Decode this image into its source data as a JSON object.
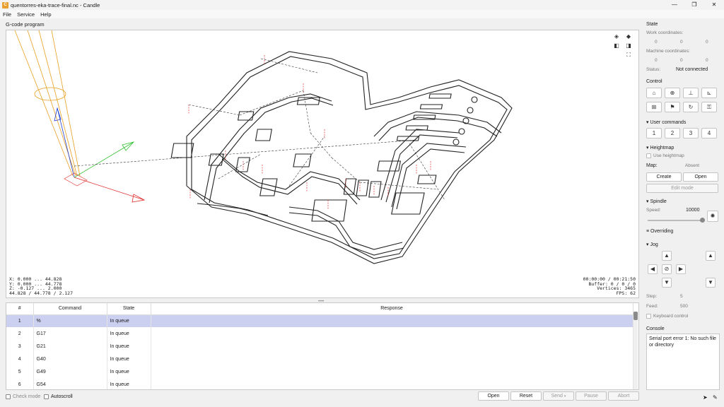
{
  "window": {
    "title": "quentorres-eka-trace-final.nc - Candle",
    "controls": [
      "—",
      "❐",
      "✕"
    ]
  },
  "menu": [
    "File",
    "Service",
    "Help"
  ],
  "gcode_label": "G-code program",
  "viewport": {
    "coords": [
      "X: 0.000 ... 44.828",
      "Y: 0.000 ... 44.778",
      "Z: -0.127 ... 2.000",
      "44.828 / 44.778 / 2.127"
    ],
    "timeinfo": [
      "00:00:00 / 00:21:50",
      "Buffer: 0 / 0 / 0",
      "Vertices: 3465",
      "FPS: 62"
    ]
  },
  "table": {
    "headers": [
      "#",
      "Command",
      "State",
      "Response"
    ],
    "rows": [
      {
        "num": "1",
        "cmd": "%",
        "state": "In queue",
        "resp": ""
      },
      {
        "num": "2",
        "cmd": "G17",
        "state": "In queue",
        "resp": ""
      },
      {
        "num": "3",
        "cmd": "G21",
        "state": "In queue",
        "resp": ""
      },
      {
        "num": "4",
        "cmd": "G40",
        "state": "In queue",
        "resp": ""
      },
      {
        "num": "5",
        "cmd": "G49",
        "state": "In queue",
        "resp": ""
      },
      {
        "num": "6",
        "cmd": "G54",
        "state": "In queue",
        "resp": ""
      }
    ]
  },
  "bottom": {
    "check_mode": "Check mode",
    "autoscroll": "Autoscroll",
    "open": "Open",
    "reset": "Reset",
    "send": "Send",
    "pause": "Pause",
    "abort": "Abort"
  },
  "state": {
    "title": "State",
    "work_label": "Work coordinates:",
    "work": [
      "0",
      "0",
      "0"
    ],
    "machine_label": "Machine coordinates:",
    "machine": [
      "0",
      "0",
      "0"
    ],
    "status_label": "Status:",
    "status_value": "Not connected"
  },
  "control": {
    "title": "Control",
    "icons": [
      "zoom-home-icon",
      "zoom-probe-icon",
      "z-zero-icon",
      "xy-zero-icon",
      "origin-icon",
      "safe-position-icon",
      "restore-icon",
      "unlock-icon"
    ]
  },
  "user_commands": {
    "title": "User commands",
    "buttons": [
      "1",
      "2",
      "3",
      "4"
    ]
  },
  "heightmap": {
    "title": "Heightmap",
    "use_label": "Use heightmap",
    "map_label": "Map:",
    "map_value": "Absent",
    "create": "Create",
    "open": "Open",
    "edit_mode": "Edit mode"
  },
  "spindle": {
    "title": "Spindle",
    "speed_label": "Speed:",
    "speed_value": "10000",
    "slider_fraction": 1.0
  },
  "overriding": {
    "title": "Overriding"
  },
  "jog": {
    "title": "Jog",
    "step_label": "Step:",
    "step_value": "5",
    "feed_label": "Feed:",
    "feed_value": "500",
    "keyboard_label": "Keyboard control"
  },
  "console": {
    "title": "Console",
    "text": "Serial port error 1: No such file or directory"
  }
}
